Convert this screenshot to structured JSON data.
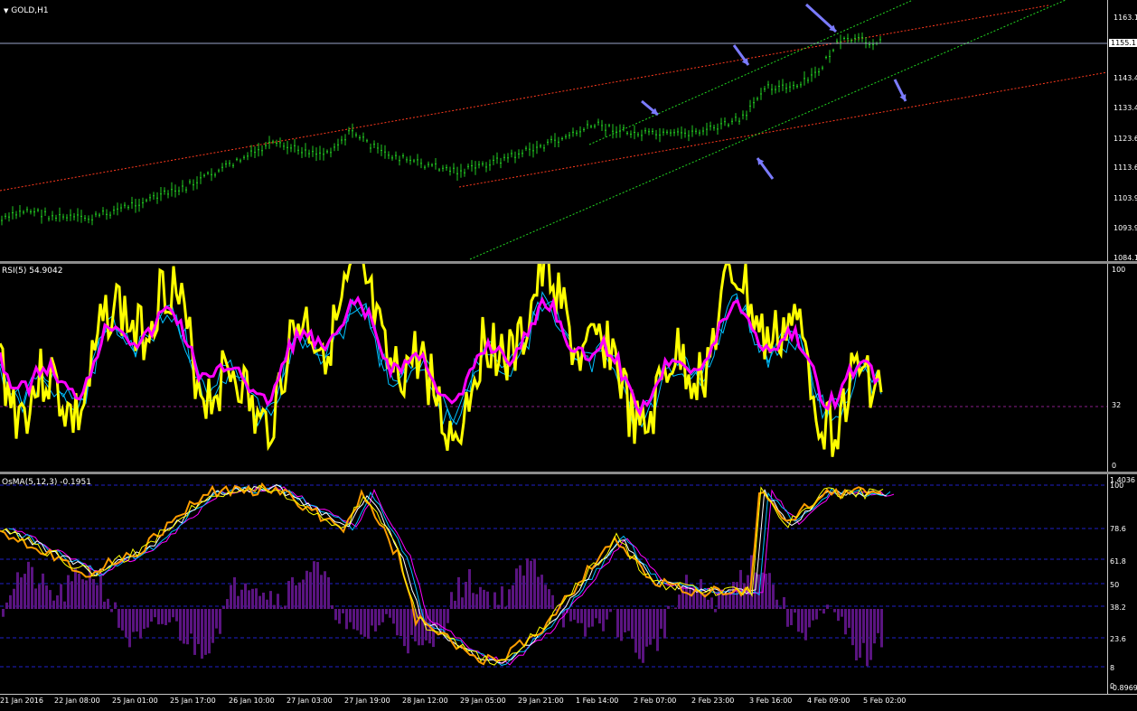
{
  "symbol": "GOLD,H1",
  "main_chart": {
    "current_price_label": "1155.1",
    "price_labels": [
      "1163.1",
      "1155.1",
      "1143.4",
      "1133.4",
      "1123.6",
      "1113.6",
      "1103.9",
      "1093.9",
      "1084.1"
    ],
    "colors": {
      "bars": "#22c722",
      "channel_red": "#ff3a1e",
      "channel_green": "#22d622",
      "arrows": "#7b7bff",
      "price_line": "#9aa3c8"
    }
  },
  "rsi_panel": {
    "title": "RSI(5) 54.9042",
    "levels": [
      "100",
      "32",
      "0"
    ],
    "colors": {
      "rsi": "#ffff00",
      "ma": "#ff00ff",
      "band": "#00bfff"
    }
  },
  "osma_panel": {
    "title": "OsMA(5,12,3) -0.1951",
    "right_labels": [
      "1.4036",
      "100",
      "78.6",
      "61.8",
      "50",
      "38.2",
      "23.6",
      "8",
      "0",
      "-0.8969"
    ],
    "colors": {
      "histogram": "#5a1480",
      "stoch_orange": "#ff9d00",
      "stoch_yellow": "#ffff00",
      "band": "#00bfff",
      "magenta": "#ff00ff",
      "level_lines": "#2020c8"
    }
  },
  "time_axis": [
    "21 Jan 2016",
    "22 Jan 08:00",
    "25 Jan 01:00",
    "25 Jan 17:00",
    "26 Jan 10:00",
    "27 Jan 03:00",
    "27 Jan 19:00",
    "28 Jan 12:00",
    "29 Jan 05:00",
    "29 Jan 21:00",
    "1 Feb 14:00",
    "2 Feb 07:00",
    "2 Feb 23:00",
    "3 Feb 16:00",
    "4 Feb 09:00",
    "5 Feb 02:00"
  ]
}
